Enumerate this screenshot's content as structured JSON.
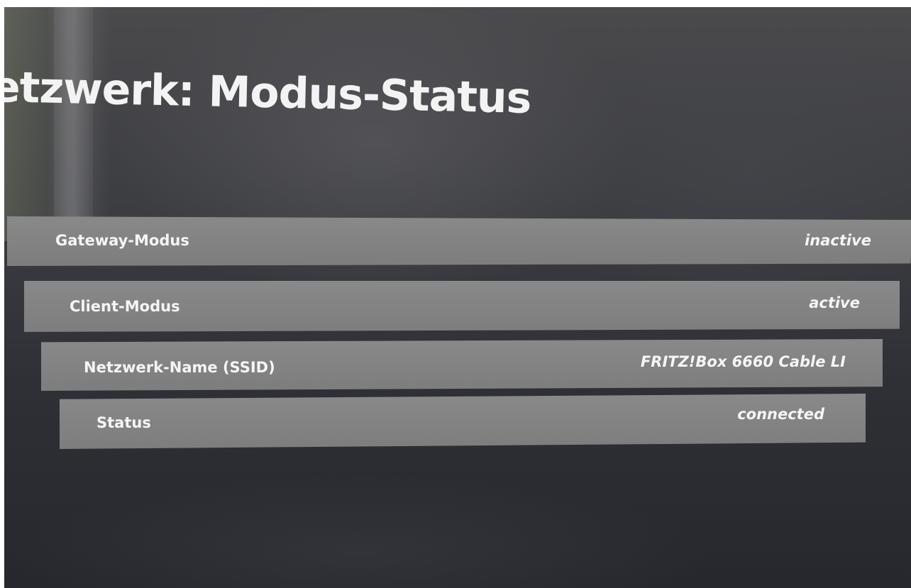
{
  "page": {
    "title": "etzwerk: Modus-Status"
  },
  "rows": [
    {
      "label": "Gateway-Modus",
      "value": "inactive"
    },
    {
      "label": "Client-Modus",
      "value": "active"
    },
    {
      "label": "Netzwerk-Name (SSID)",
      "value": "FRITZ!Box 6660 Cable LI"
    },
    {
      "label": "Status",
      "value": "connected"
    }
  ],
  "colors": {
    "background": "#3a3b40",
    "row": "#858585",
    "text": "#f5f5f5"
  }
}
